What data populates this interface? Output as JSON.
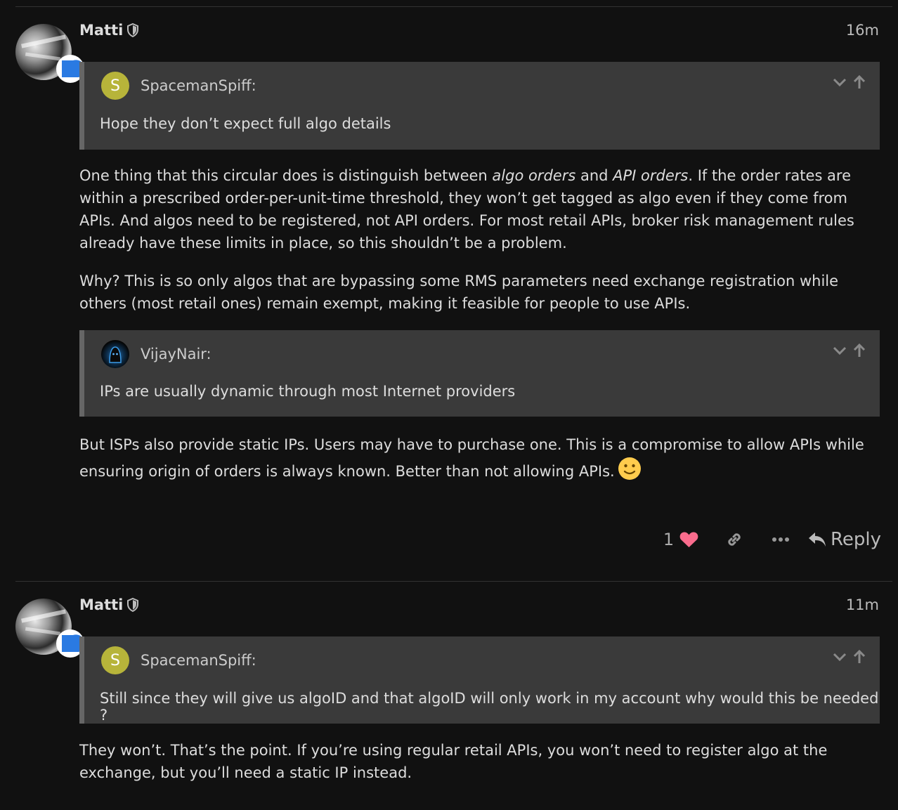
{
  "posts": [
    {
      "author": "Matti",
      "time": "16m",
      "quotes": [
        {
          "author": "SpacemanSpiff:",
          "avatar_letter": "S",
          "text": "Hope they don’t expect full algo details"
        }
      ],
      "para1_a": "One thing that this circular does is distinguish between ",
      "para1_em1": "algo orders",
      "para1_b": " and ",
      "para1_em2": "API orders",
      "para1_c": ". If the order rates are within a prescribed order-per-unit-time threshold, they won’t get tagged as algo even if they come from APIs. And algos need to be registered, not API orders. For most retail APIs, broker risk management rules already have these limits in place, so this shouldn’t be a problem.",
      "para2": "Why? This is so only algos that are bypassing some RMS parameters need exchange registration while others (most retail ones) remain exempt, making it feasible for people to use APIs.",
      "quote2": {
        "author": "VijayNair:",
        "text": "IPs are usually dynamic through most Internet providers"
      },
      "para3": "But ISPs also provide static IPs. Users may have to purchase one. This is a compromise to allow APIs while ensuring origin of orders is always known. Better than not allowing APIs.",
      "like_count": "1",
      "reply_label": "Reply"
    },
    {
      "author": "Matti",
      "time": "11m",
      "quote": {
        "author": "SpacemanSpiff:",
        "avatar_letter": "S",
        "text": "Still since they will give us algoID and that algoID will only work in my account why would this be needed ?"
      },
      "para1": "They won’t. That’s the point. If you’re using regular retail APIs, you won’t need to register algo at the exchange, but you’ll need a static IP instead."
    }
  ],
  "colors": {
    "background": "#111111",
    "quote_bg": "#3a3a3a",
    "heart": "#fa6c8d",
    "letter_avatar": "#b7b43a"
  }
}
